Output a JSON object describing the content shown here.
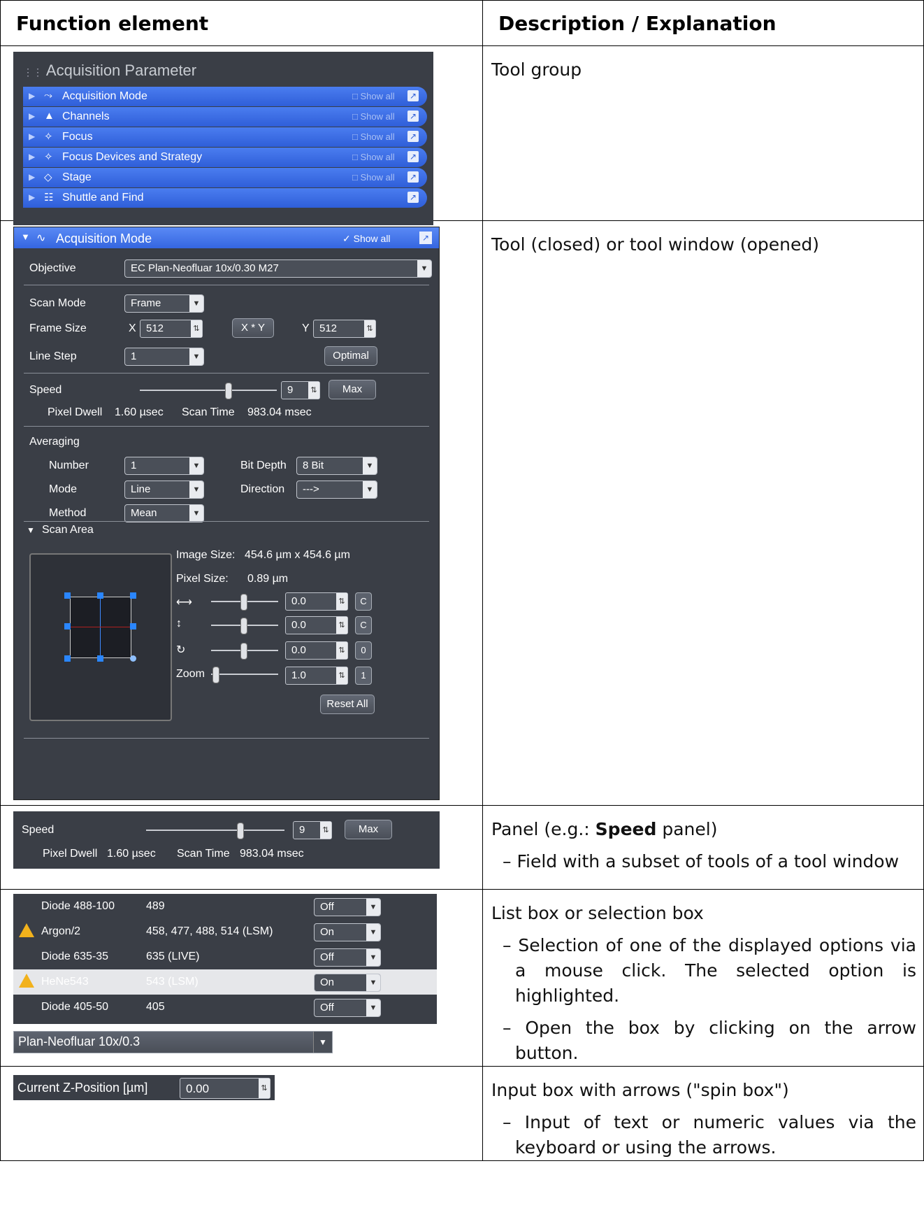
{
  "headers": {
    "col1": "Function element",
    "col2": "Description / Explanation"
  },
  "rows": [
    {
      "desc": "Tool group"
    },
    {
      "desc": "Tool (closed) or tool window (opened)"
    },
    {
      "desc_prefix": "Panel (e.g.: ",
      "desc_bold": "Speed",
      "desc_suffix": " panel)",
      "bullets": [
        "Field with a subset of tools of a tool window"
      ]
    },
    {
      "desc": "List box or selection box",
      "bullets": [
        "Selection of one of the displayed options via a mouse click. The selected option is highlighted.",
        "Open the box by clicking on the arrow button."
      ]
    },
    {
      "desc": "Input box with arrows (\"spin box\")",
      "bullets": [
        "Input of text or numeric values via the keyboard or using the arrows."
      ]
    }
  ],
  "tool_group": {
    "title": "Acquisition Parameter",
    "show_all": "Show all",
    "items": [
      {
        "label": "Acquisition Mode",
        "icon": "wave-icon",
        "glyph": "⤳"
      },
      {
        "label": "Channels",
        "icon": "channels-icon",
        "glyph": "▲"
      },
      {
        "label": "Focus",
        "icon": "focus-icon",
        "glyph": "✧"
      },
      {
        "label": "Focus Devices and Strategy",
        "icon": "focus-devices-icon",
        "glyph": "✧"
      },
      {
        "label": "Stage",
        "icon": "stage-icon",
        "glyph": "◇"
      },
      {
        "label": "Shuttle and Find",
        "icon": "shuttle-icon",
        "glyph": "☷"
      }
    ]
  },
  "tool_window": {
    "title": "Acquisition Mode",
    "show_all": "Show all",
    "objective_label": "Objective",
    "objective_value": "EC Plan-Neofluar 10x/0.30 M27",
    "scan_mode_label": "Scan Mode",
    "scan_mode_value": "Frame",
    "frame_size_label": "Frame Size",
    "x_label": "X",
    "x_value": "512",
    "xy_button": "X * Y",
    "y_label": "Y",
    "y_value": "512",
    "line_step_label": "Line Step",
    "line_step_value": "1",
    "optimal_button": "Optimal",
    "speed_label": "Speed",
    "speed_value": "9",
    "max_button": "Max",
    "pixel_dwell_label": "Pixel Dwell",
    "pixel_dwell_value": "1.60 µsec",
    "scan_time_label": "Scan Time",
    "scan_time_value": "983.04 msec",
    "averaging_label": "Averaging",
    "number_label": "Number",
    "number_value": "1",
    "bit_depth_label": "Bit Depth",
    "bit_depth_value": "8 Bit",
    "mode_label": "Mode",
    "mode_value": "Line",
    "direction_label": "Direction",
    "direction_value": "--->",
    "method_label": "Method",
    "method_value": "Mean",
    "scan_area_label": "Scan Area",
    "image_size_label": "Image Size:",
    "image_size_value": "454.6 µm x 454.6 µm",
    "pixel_size_label": "Pixel Size:",
    "pixel_size_value": "0.89 µm",
    "offset_x": "0.0",
    "offset_y": "0.0",
    "rotation": "0.0",
    "zoom_label": "Zoom",
    "zoom_value": "1.0",
    "btn_c": "C",
    "btn_0": "0",
    "btn_1": "1",
    "reset_all_button": "Reset All"
  },
  "speed_panel": {
    "speed_label": "Speed",
    "speed_value": "9",
    "max_button": "Max",
    "pixel_dwell_label": "Pixel Dwell",
    "pixel_dwell_value": "1.60 µsec",
    "scan_time_label": "Scan Time",
    "scan_time_value": "983.04 msec"
  },
  "list_box": {
    "rows": [
      {
        "name": "Diode 488-100",
        "wavelength": "489",
        "state": "Off",
        "warn": false,
        "selected": false
      },
      {
        "name": "Argon/2",
        "wavelength": "458, 477, 488, 514 (LSM)",
        "state": "On",
        "warn": true,
        "selected": false
      },
      {
        "name": "Diode 635-35",
        "wavelength": "635 (LIVE)",
        "state": "Off",
        "warn": false,
        "selected": false
      },
      {
        "name": "HeNe543",
        "wavelength": "543 (LSM)",
        "state": "On",
        "warn": true,
        "selected": true
      },
      {
        "name": "Diode 405-50",
        "wavelength": "405",
        "state": "Off",
        "warn": false,
        "selected": false
      }
    ],
    "combo_value": "Plan-Neofluar 10x/0.3"
  },
  "spin_box": {
    "label": "Current Z-Position [µm]",
    "value": "0.00"
  }
}
